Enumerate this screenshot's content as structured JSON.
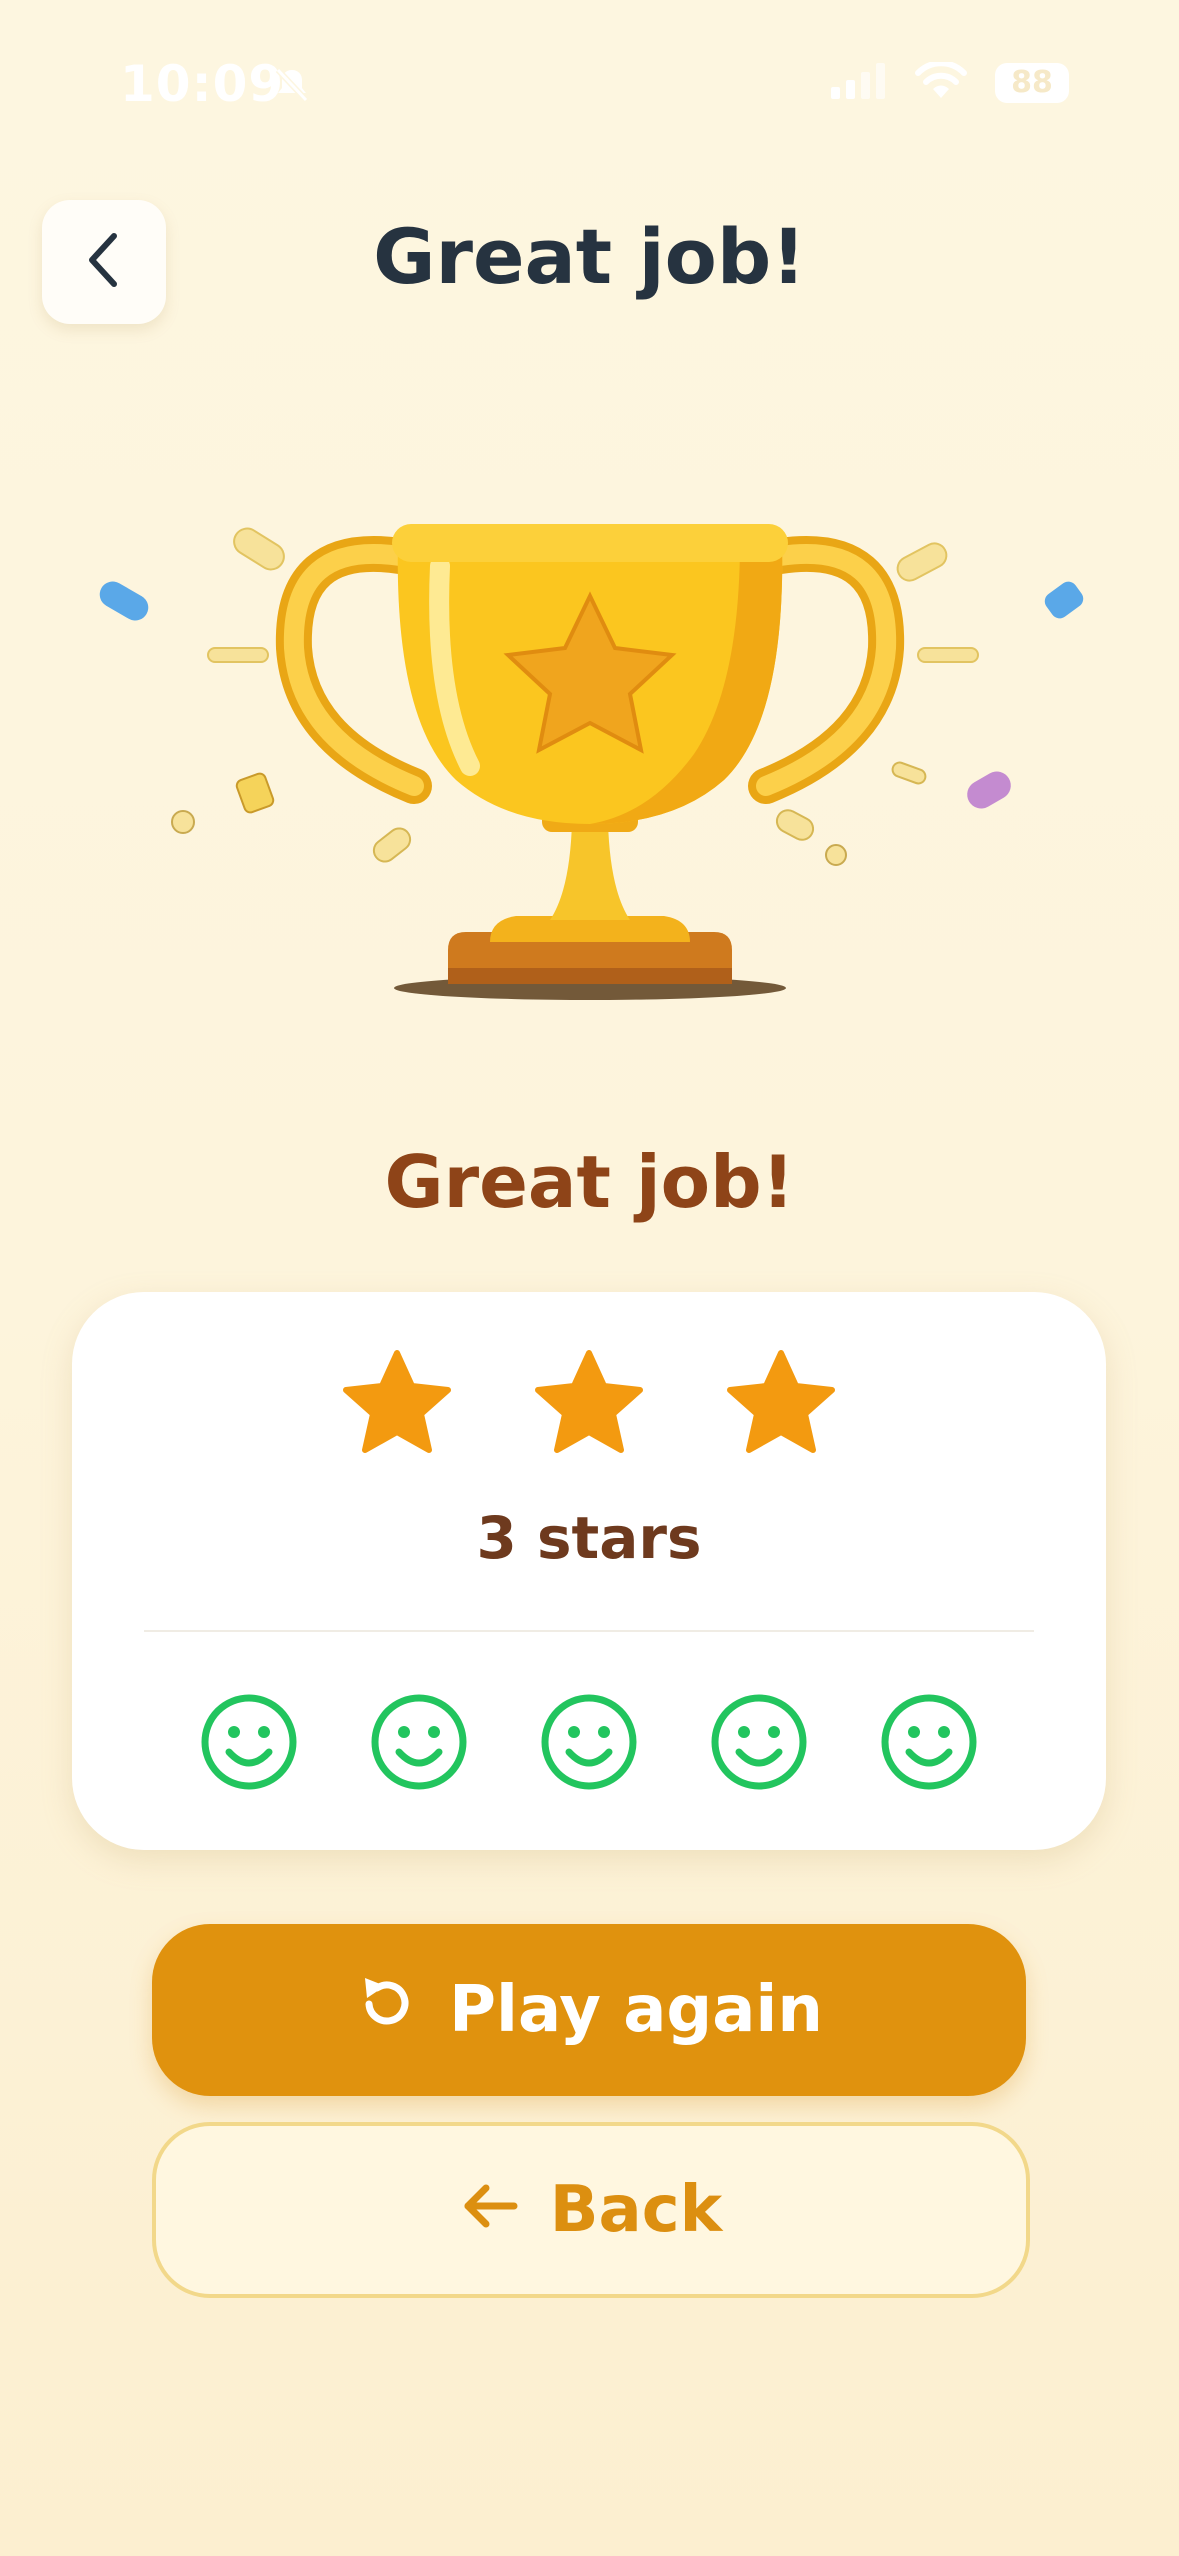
{
  "status_bar": {
    "time": "10:09",
    "battery": "88"
  },
  "header": {
    "title": "Great job!",
    "back_icon": "chevron-left-icon"
  },
  "hero": {
    "image": "trophy-with-star-and-confetti"
  },
  "result": {
    "title": "Great job!",
    "stars_earned": 3,
    "stars_total": 3,
    "stars_label": "3 stars",
    "smileys": [
      "happy",
      "happy",
      "happy",
      "happy",
      "happy"
    ]
  },
  "actions": {
    "play_again_label": "Play again",
    "play_again_icon": "restart-icon",
    "back_label": "Back",
    "back_icon": "arrow-left-icon"
  },
  "colors": {
    "accent": "#e0920e",
    "star": "#f39a10",
    "smiley": "#22c55e",
    "title_brown": "#8e4418"
  }
}
